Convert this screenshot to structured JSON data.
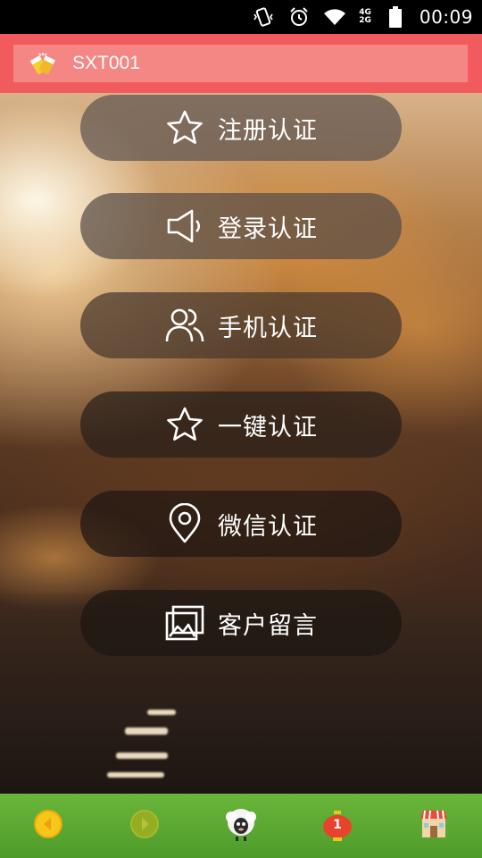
{
  "status_bar": {
    "network_top": "4G",
    "network_bottom": "2G",
    "time": "00:09"
  },
  "header": {
    "title": "SXT001",
    "bg_color": "#f25b5e",
    "bar_color": "#f48784"
  },
  "menu": {
    "items": [
      {
        "label": "注册认证",
        "icon": "star-icon"
      },
      {
        "label": "登录认证",
        "icon": "speaker-icon"
      },
      {
        "label": "手机认证",
        "icon": "users-icon"
      },
      {
        "label": "一键认证",
        "icon": "star-icon"
      },
      {
        "label": "微信认证",
        "icon": "location-pin-icon"
      },
      {
        "label": "客户留言",
        "icon": "gallery-icon"
      }
    ]
  },
  "bottom_nav": {
    "items": [
      {
        "name": "back-arrow-icon"
      },
      {
        "name": "forward-arrow-icon"
      },
      {
        "name": "sheep-icon"
      },
      {
        "name": "lantern-icon",
        "badge": "1"
      },
      {
        "name": "shop-icon"
      }
    ],
    "bg_color": "#5aa62f"
  }
}
